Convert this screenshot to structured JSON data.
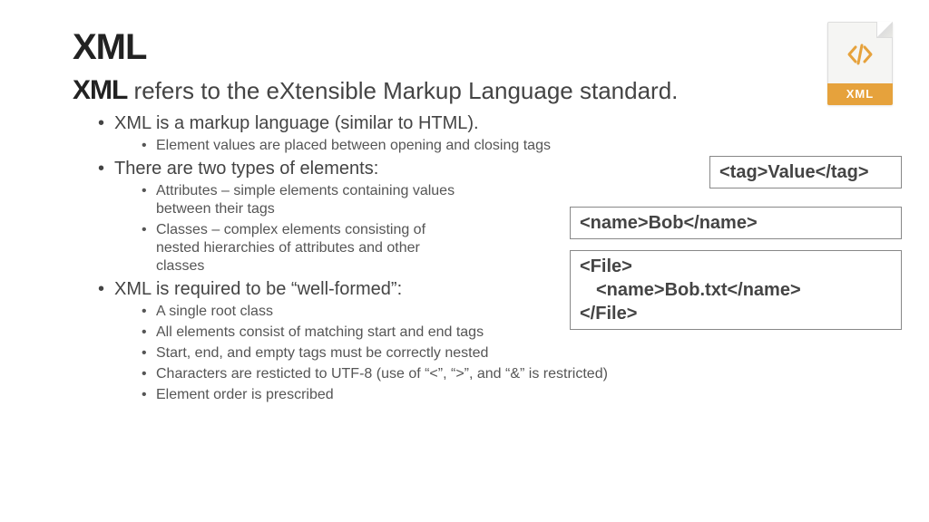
{
  "title": "XML",
  "subtitle_bold": "XML",
  "subtitle_rest": " refers to the eXtensible Markup Language standard.",
  "icon": {
    "label": "XML",
    "name": "xml-file-icon"
  },
  "bullets": {
    "b1": "XML is a markup language (similar to HTML).",
    "b1_1": "Element values are placed between opening and closing tags",
    "b2": "There are two types of elements:",
    "b2_1": "Attributes – simple elements containing values between their tags",
    "b2_2": "Classes – complex elements consisting of nested hierarchies of attributes and other classes",
    "b3": "XML is required to be “well-formed”:",
    "b3_1": "A single root class",
    "b3_2": "All elements consist of matching start and end tags",
    "b3_3": "Start, end, and empty tags must be correctly nested",
    "b3_4": "Characters are resticted to UTF-8 (use of “<”, “>”, and “&” is restricted)",
    "b3_5": "Element order is prescribed"
  },
  "code": {
    "box1": "<tag>Value</tag>",
    "box2": "<name>Bob</name>",
    "box3_l1": "<File>",
    "box3_l2": "<name>Bob.txt</name>",
    "box3_l3": "</File>"
  }
}
